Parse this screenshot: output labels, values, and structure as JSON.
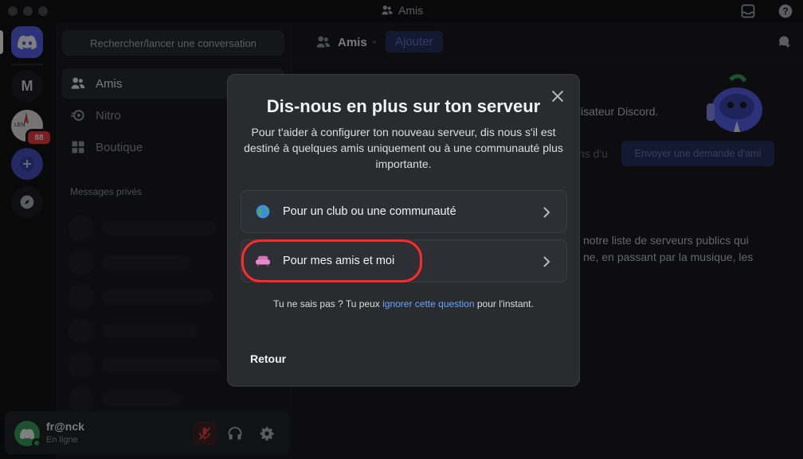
{
  "window": {
    "title": "Amis"
  },
  "rail": {
    "server_m_letter": "M",
    "badge_count": "88",
    "server_img_text": "LEN"
  },
  "channels": {
    "search_label": "Rechercher/lancer une conversation",
    "nav": [
      {
        "label": "Amis",
        "icon": "friends-icon"
      },
      {
        "label": "Nitro",
        "icon": "nitro-icon"
      },
      {
        "label": "Boutique",
        "icon": "shop-icon"
      }
    ],
    "dm_header": "Messages privés"
  },
  "user": {
    "name": "fr@nck",
    "status": "En ligne"
  },
  "topbar": {
    "friends_label": "Amis",
    "add_label": "Ajouter"
  },
  "background": {
    "line1": "tilisateur Discord.",
    "partial": "ns d'u",
    "send_request": "Envoyer une demande d'ami",
    "line2": "notre liste de serveurs publics qui",
    "line3": "ne, en passant par la musique, les"
  },
  "modal": {
    "title": "Dis-nous en plus sur ton serveur",
    "subtitle": "Pour t'aider à configurer ton nouveau serveur, dis nous s'il est destiné à quelques amis uniquement ou à une communauté plus importante.",
    "options": [
      {
        "label": "Pour un club ou une communauté",
        "icon": "globe-icon"
      },
      {
        "label": "Pour mes amis et moi",
        "icon": "couch-icon"
      }
    ],
    "footer_before": "Tu ne sais pas ? Tu peux ",
    "footer_link": "ignorer cette question",
    "footer_after": " pour l'instant.",
    "back_label": "Retour"
  },
  "colors": {
    "accent": "#5865f2",
    "highlight": "#ff2a2a",
    "link": "#5fa8ff",
    "online": "#3ba55d"
  }
}
